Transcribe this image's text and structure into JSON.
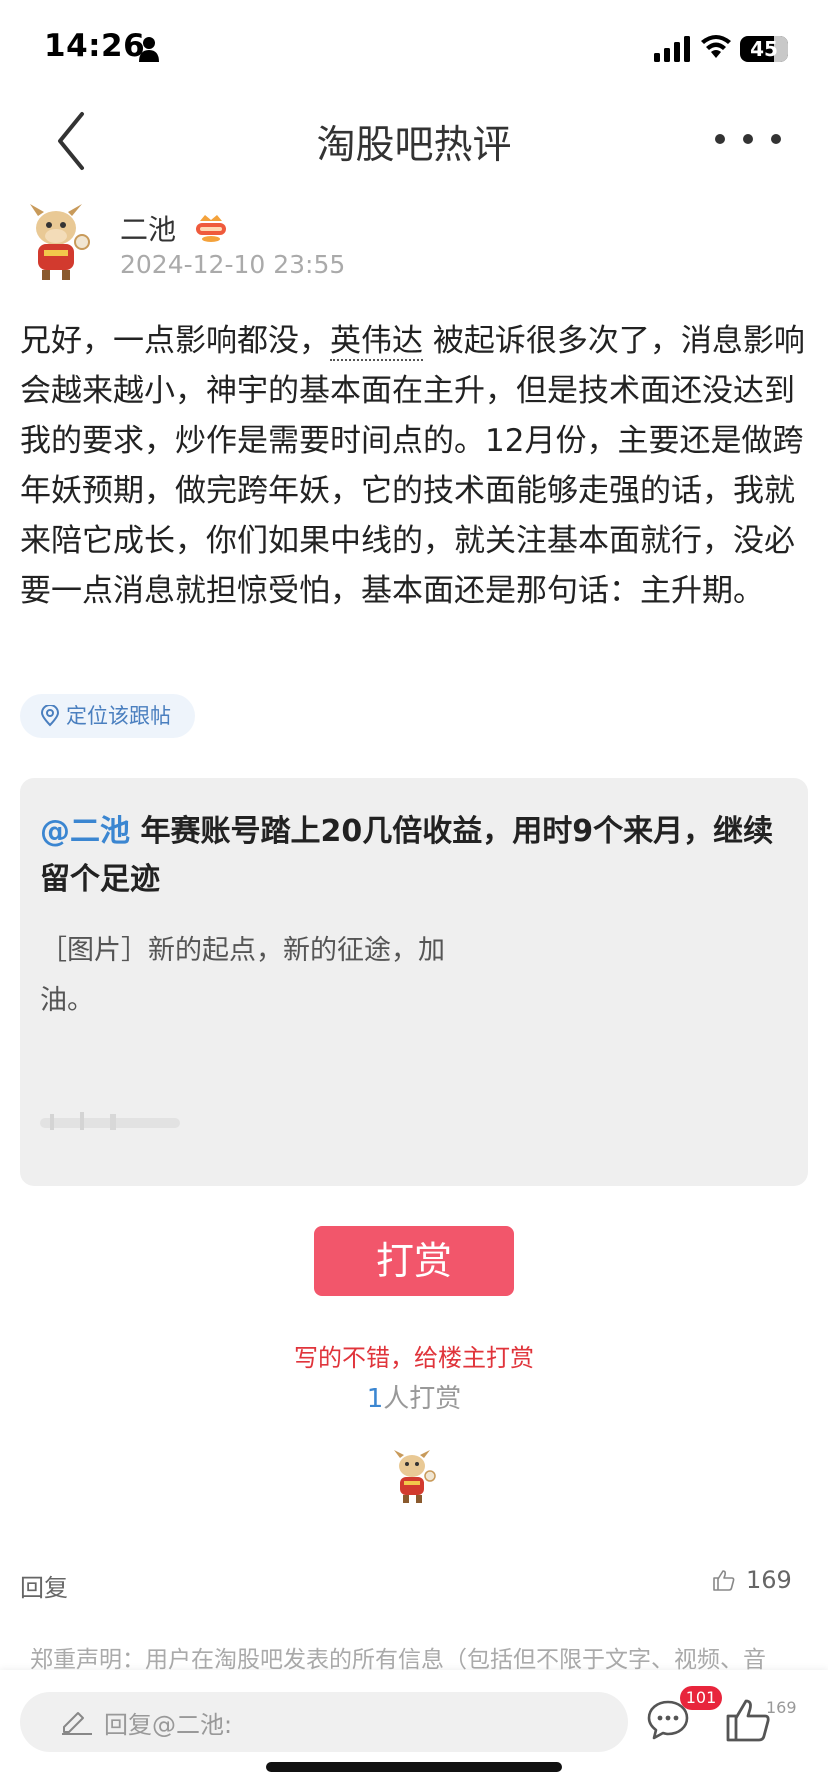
{
  "status_bar": {
    "time": "14:26",
    "battery": "45"
  },
  "nav": {
    "title": "淘股吧热评"
  },
  "post": {
    "author": "二池",
    "time": "2024-12-10 23:55",
    "body_before_link": "兄好，一点影响都没，",
    "stock_link": "英伟达",
    "body_after_link": " 被起诉很多次了，消息影响会越来越小，神宇的基本面在主升，但是技术面还没达到我的要求，炒作是需要时间点的。12月份，主要还是做跨年妖预期，做完跨年妖，它的技术面能够走强的话，我就来陪它成长，你们如果中线的，就关注基本面就行，没必要一点消息就担惊受怕，基本面还是那句话：主升期。",
    "locate_label": "定位该跟帖"
  },
  "quote": {
    "mention": "@二池",
    "headline": " 年赛账号踏上20几倍收益，用时9个来月，继续留个足迹",
    "text": "［图片］新的起点，新的征途，加油。"
  },
  "tip": {
    "button_label": "打赏",
    "slogan": "写的不错，给楼主打赏",
    "count": "1",
    "count_suffix": "人打赏"
  },
  "actions": {
    "reply_label": "回复",
    "like_count": "169"
  },
  "disclaimer": "郑重声明：用户在淘股吧发表的所有信息（包括但不限于文字、视频、音",
  "bottom_bar": {
    "reply_placeholder": "回复@二池:",
    "comment_count": "101",
    "like_count": "169"
  },
  "colors": {
    "accent_red": "#f2566b",
    "link_blue": "#3b86d1",
    "slogan_red": "#e0343b"
  },
  "icons": [
    "person-icon",
    "signal-icon",
    "wifi-icon",
    "battery-icon",
    "back-icon",
    "more-icon",
    "location-pin-icon",
    "thumbs-up-icon",
    "pen-icon",
    "comment-icon"
  ]
}
